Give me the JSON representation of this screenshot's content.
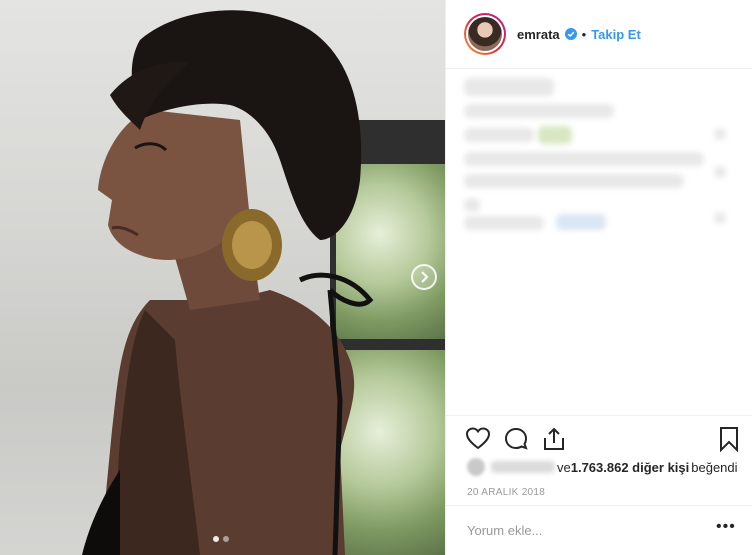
{
  "post": {
    "media": {
      "dot_count": 2,
      "active_dot": 0,
      "next_icon": "chevron-right-icon"
    },
    "header": {
      "username": "emrata",
      "verified_icon": "verified-badge-icon",
      "separator": "•",
      "follow_label": "Takip Et"
    },
    "actions": {
      "like_icon": "heart-icon",
      "comment_icon": "comment-icon",
      "share_icon": "share-icon",
      "save_icon": "bookmark-icon"
    },
    "likes": {
      "prefix": "ve ",
      "count_text": "1.763.862 diğer kişi",
      "suffix": " beğendi"
    },
    "date": "20 ARALIK 2018",
    "comment": {
      "placeholder": "Yorum ekle...",
      "more_label": "•••"
    },
    "colors": {
      "accent": "#3897f0",
      "text": "#262626",
      "muted": "#999999",
      "divider": "#efefef"
    }
  }
}
